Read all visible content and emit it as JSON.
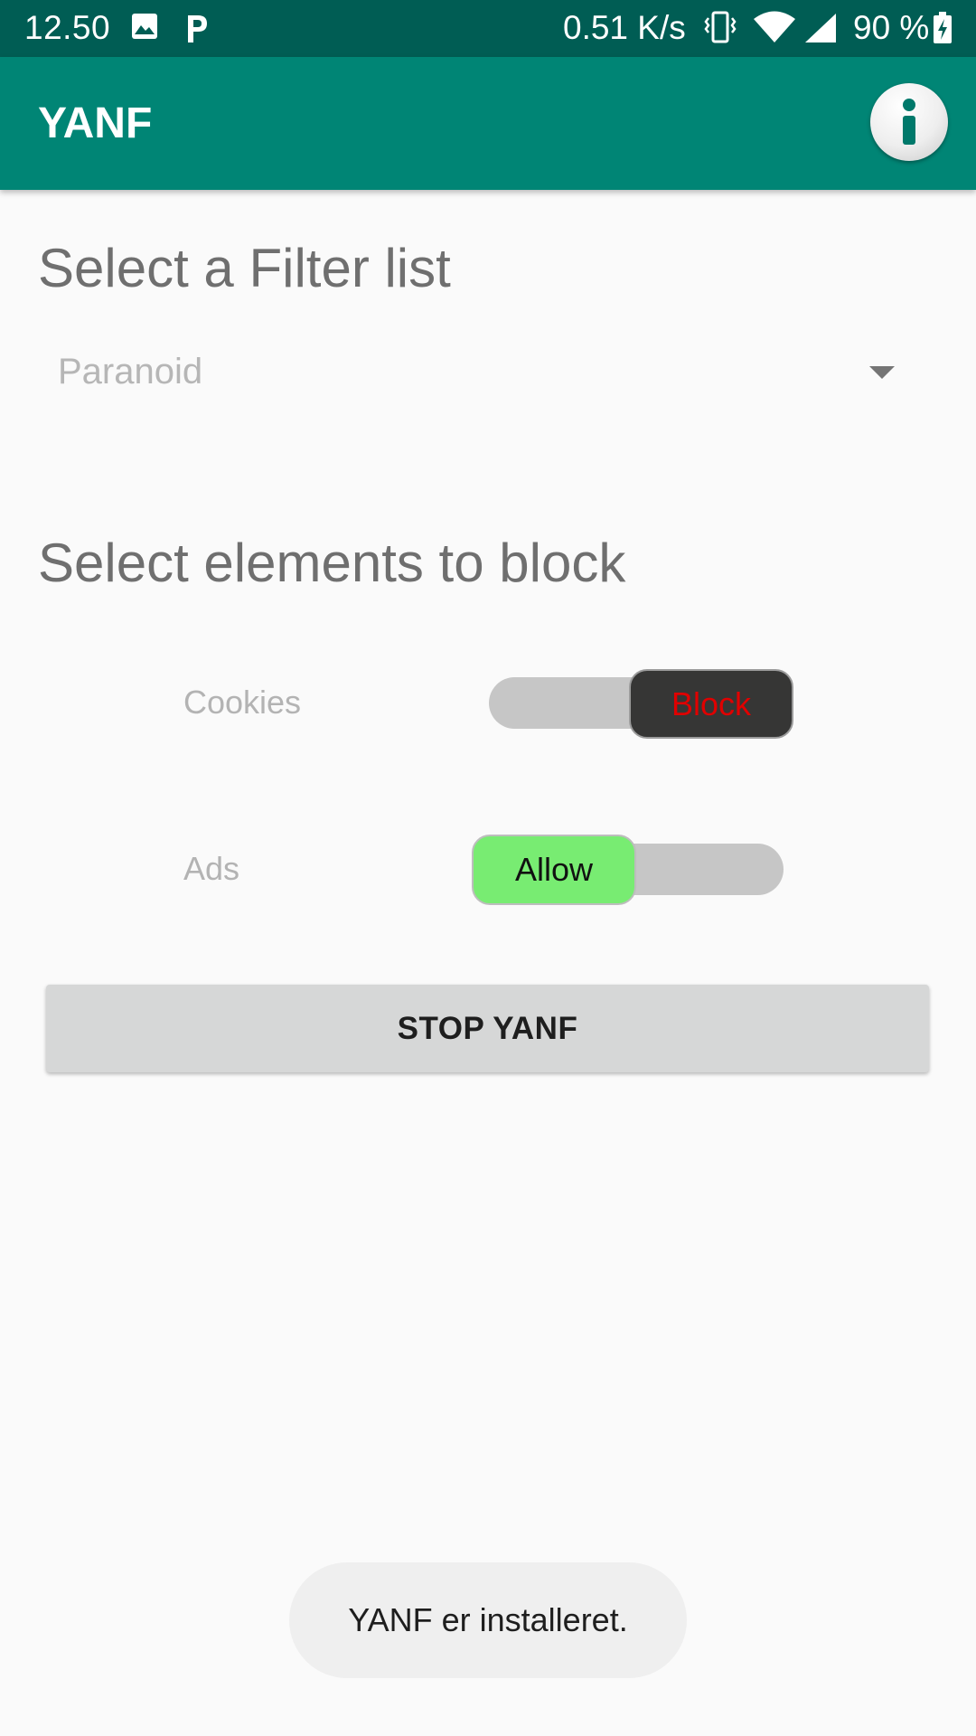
{
  "status_bar": {
    "time": "12.50",
    "speed": "0.51 K/s",
    "battery": "90 %",
    "icons": [
      "image-icon",
      "p-icon",
      "vibrate-icon",
      "wifi-icon",
      "signal-icon",
      "battery-icon"
    ]
  },
  "app_bar": {
    "title": "YANF",
    "info_icon": "info-icon"
  },
  "filter_section": {
    "title": "Select a Filter list",
    "selected_value": "Paranoid"
  },
  "block_section": {
    "title": "Select elements to block",
    "rows": [
      {
        "label": "Cookies",
        "state_label": "Block"
      },
      {
        "label": "Ads",
        "state_label": "Allow"
      }
    ]
  },
  "stop_button": {
    "label": "STOP YANF"
  },
  "toast": {
    "message": "YANF er installeret."
  },
  "colors": {
    "status_bar": "#005d54",
    "app_bar": "#008575",
    "block_thumb": "#363635",
    "block_text": "#e00000",
    "allow_thumb": "#78ec72"
  }
}
